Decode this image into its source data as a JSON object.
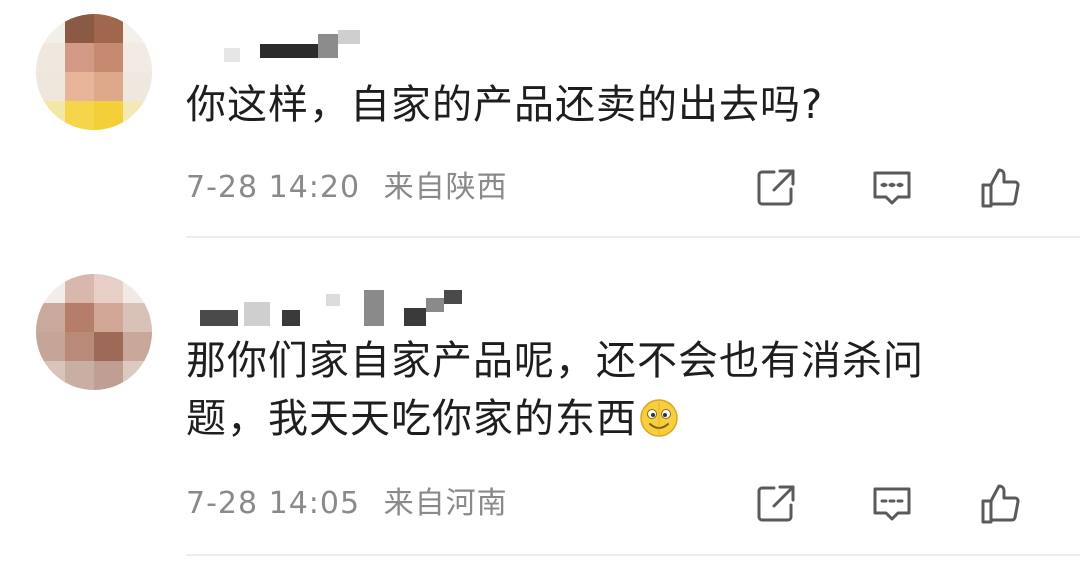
{
  "comments": [
    {
      "text": "你这样，自家的产品还卖的出去吗?",
      "time": "7-28 14:20",
      "location": "来自陕西"
    },
    {
      "text_line1": "那你们家自家产品呢，还不会也有消杀问",
      "text_line2": "题，我天天吃你家的东西",
      "time": "7-28 14:05",
      "location": "来自河南"
    }
  ],
  "icons": {
    "share": "share-icon",
    "reply": "comment-icon",
    "like": "thumbs-up-icon",
    "emoji": "emoji-icon"
  },
  "colors": {
    "text": "#1e1e1e",
    "meta": "#8a8a8a",
    "icon": "#5a5a5a",
    "divider": "#ececec"
  }
}
